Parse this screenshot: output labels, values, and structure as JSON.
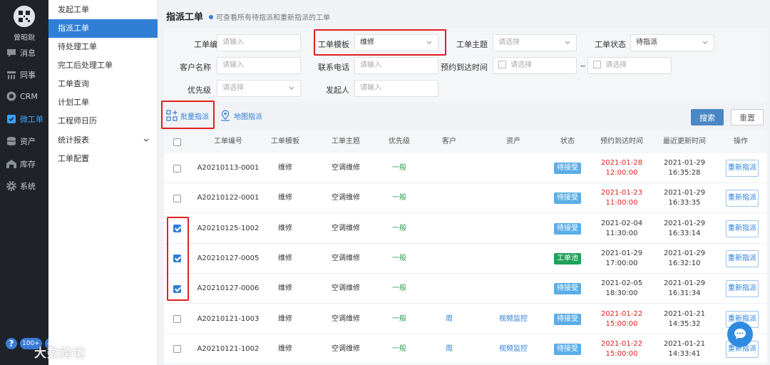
{
  "user": {
    "name": "曾昭銳"
  },
  "rail": [
    {
      "label": "消息",
      "icon": "message-icon"
    },
    {
      "label": "同事",
      "icon": "colleagues-icon"
    },
    {
      "label": "CRM",
      "icon": "crm-icon"
    },
    {
      "label": "微工单",
      "icon": "work-order-icon"
    },
    {
      "label": "资产",
      "icon": "assets-icon"
    },
    {
      "label": "库存",
      "icon": "inventory-icon"
    },
    {
      "label": "系统",
      "icon": "system-gear-icon"
    }
  ],
  "rail_bottom": {
    "badge": "100+"
  },
  "menu": [
    {
      "label": "发起工单"
    },
    {
      "label": "指派工单",
      "active": true
    },
    {
      "label": "待处理工单"
    },
    {
      "label": "完工后处理工单"
    },
    {
      "label": "工单查询"
    },
    {
      "label": "计划工单"
    },
    {
      "label": "工程师日历"
    },
    {
      "label": "统计报表"
    },
    {
      "label": "工单配置"
    }
  ],
  "page": {
    "title": "指派工单",
    "hint": "可查看所有待指派和重新指派的工单"
  },
  "filters": {
    "order_no": {
      "label": "工单编号",
      "placeholder": "请输入"
    },
    "template": {
      "label": "工单模板",
      "value": "维修"
    },
    "subject": {
      "label": "工单主题",
      "placeholder": "请选择"
    },
    "status": {
      "label": "工单状态",
      "value": "待指派"
    },
    "customer": {
      "label": "客户名称",
      "placeholder": "请输入"
    },
    "phone": {
      "label": "联系电话",
      "placeholder": "请输入"
    },
    "arrival": {
      "label": "预约到达时间",
      "start_placeholder": "请选择",
      "separator": "~",
      "end_placeholder": "请选择"
    },
    "priority": {
      "label": "优先级",
      "placeholder": "请选择"
    },
    "initiator": {
      "label": "发起人",
      "placeholder": "请输入"
    }
  },
  "actions": {
    "batch_assign": "批量指派",
    "map_assign": "地图指派",
    "search": "搜索",
    "reset": "重置"
  },
  "table": {
    "headers": [
      "工单编号",
      "工单模板",
      "工单主题",
      "优先级",
      "客户",
      "资产",
      "状态",
      "预约到达时间",
      "最近更新时间",
      "操作"
    ],
    "rows": [
      {
        "checked": false,
        "no": "A20210113-0001",
        "template": "维修",
        "subject": "空调维修",
        "priority": "一般",
        "customer": "",
        "asset": "",
        "status": "待接受",
        "status_color": "blue",
        "arr_date": "2021-01-28",
        "arr_time": "12:00:00",
        "arr_red": true,
        "upd_date": "2021-01-29",
        "upd_time": "16:35:28",
        "op": "重新指派"
      },
      {
        "checked": false,
        "no": "A20210122-0001",
        "template": "维修",
        "subject": "空调维修",
        "priority": "一般",
        "customer": "",
        "asset": "",
        "status": "待接受",
        "status_color": "blue",
        "arr_date": "2021-01-23",
        "arr_time": "11:00:00",
        "arr_red": true,
        "upd_date": "2021-01-29",
        "upd_time": "16:33:35",
        "op": "重新指派"
      },
      {
        "checked": true,
        "no": "A20210125-1002",
        "template": "维修",
        "subject": "空调维修",
        "priority": "一般",
        "customer": "",
        "asset": "",
        "status": "待接受",
        "status_color": "blue",
        "arr_date": "2021-02-04",
        "arr_time": "11:30:00",
        "arr_red": false,
        "upd_date": "2021-01-29",
        "upd_time": "16:33:14",
        "op": "重新指派"
      },
      {
        "checked": true,
        "no": "A20210127-0005",
        "template": "维修",
        "subject": "空调维修",
        "priority": "一般",
        "customer": "",
        "asset": "",
        "status": "工单池",
        "status_color": "green",
        "arr_date": "2021-01-29",
        "arr_time": "17:00:00",
        "arr_red": false,
        "upd_date": "2021-01-29",
        "upd_time": "16:32:10",
        "op": "重新指派"
      },
      {
        "checked": true,
        "no": "A20210127-0006",
        "template": "维修",
        "subject": "空调维修",
        "priority": "一般",
        "customer": "",
        "asset": "",
        "status": "待接受",
        "status_color": "blue",
        "arr_date": "2021-02-05",
        "arr_time": "18:30:00",
        "arr_red": false,
        "upd_date": "2021-01-29",
        "upd_time": "16:31:34",
        "op": "重新指派"
      },
      {
        "checked": false,
        "no": "A20210121-1003",
        "template": "维修",
        "subject": "空调维修",
        "priority": "一般",
        "customer": "周",
        "asset": "视频监控",
        "status": "待接受",
        "status_color": "blue",
        "arr_date": "2021-01-22",
        "arr_time": "15:00:00",
        "arr_red": true,
        "upd_date": "2021-01-21",
        "upd_time": "14:35:32",
        "op": "重新指派"
      },
      {
        "checked": false,
        "no": "A20210121-1002",
        "template": "维修",
        "subject": "空调维修",
        "priority": "一般",
        "customer": "周",
        "asset": "视频监控",
        "status": "待接受",
        "status_color": "blue",
        "arr_date": "2021-01-22",
        "arr_time": "15:00:00",
        "arr_red": true,
        "upd_date": "2021-01-21",
        "upd_time": "14:33:41",
        "op": "重新指派"
      }
    ]
  },
  "watermark": "大数跨境",
  "colors": {
    "primary": "#2f7fd6",
    "highlight": "#e02020",
    "priority": "#2e9d4e",
    "pending_badge": "#5aaee8",
    "pool_badge": "#21a05a"
  }
}
